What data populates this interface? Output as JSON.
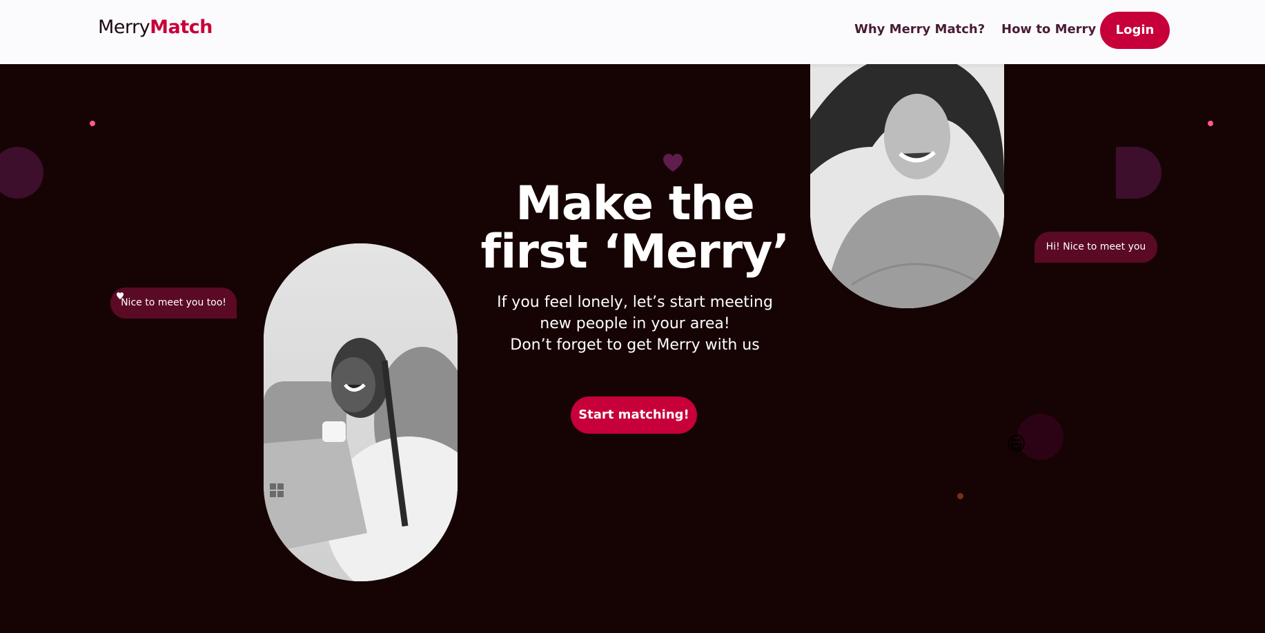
{
  "nav": {
    "logo_regular": "Merry",
    "logo_bold": "Match",
    "links": [
      {
        "label": "Why Merry Match?"
      },
      {
        "label": "How to Merry"
      }
    ],
    "login_label": "Login"
  },
  "hero": {
    "headline_line1": "Make the",
    "headline_line2": "first ‘Merry’",
    "subtitle_line1": "If you feel lonely, let’s start meeting",
    "subtitle_line2": "new people in your area!",
    "subtitle_line3": "Don’t forget to get Merry with us",
    "cta_label": "Start matching!",
    "bubble_left": "Nice to meet you too!",
    "bubble_right": "Hi! Nice to meet you",
    "emoji": "😄"
  },
  "colors": {
    "brand": "#c70039",
    "background": "#160404",
    "navbar": "#fbfbfd",
    "bubble": "#5a0a24",
    "decor_purple": "#3d0f2c",
    "decor_pink": "#ff5a8a"
  }
}
